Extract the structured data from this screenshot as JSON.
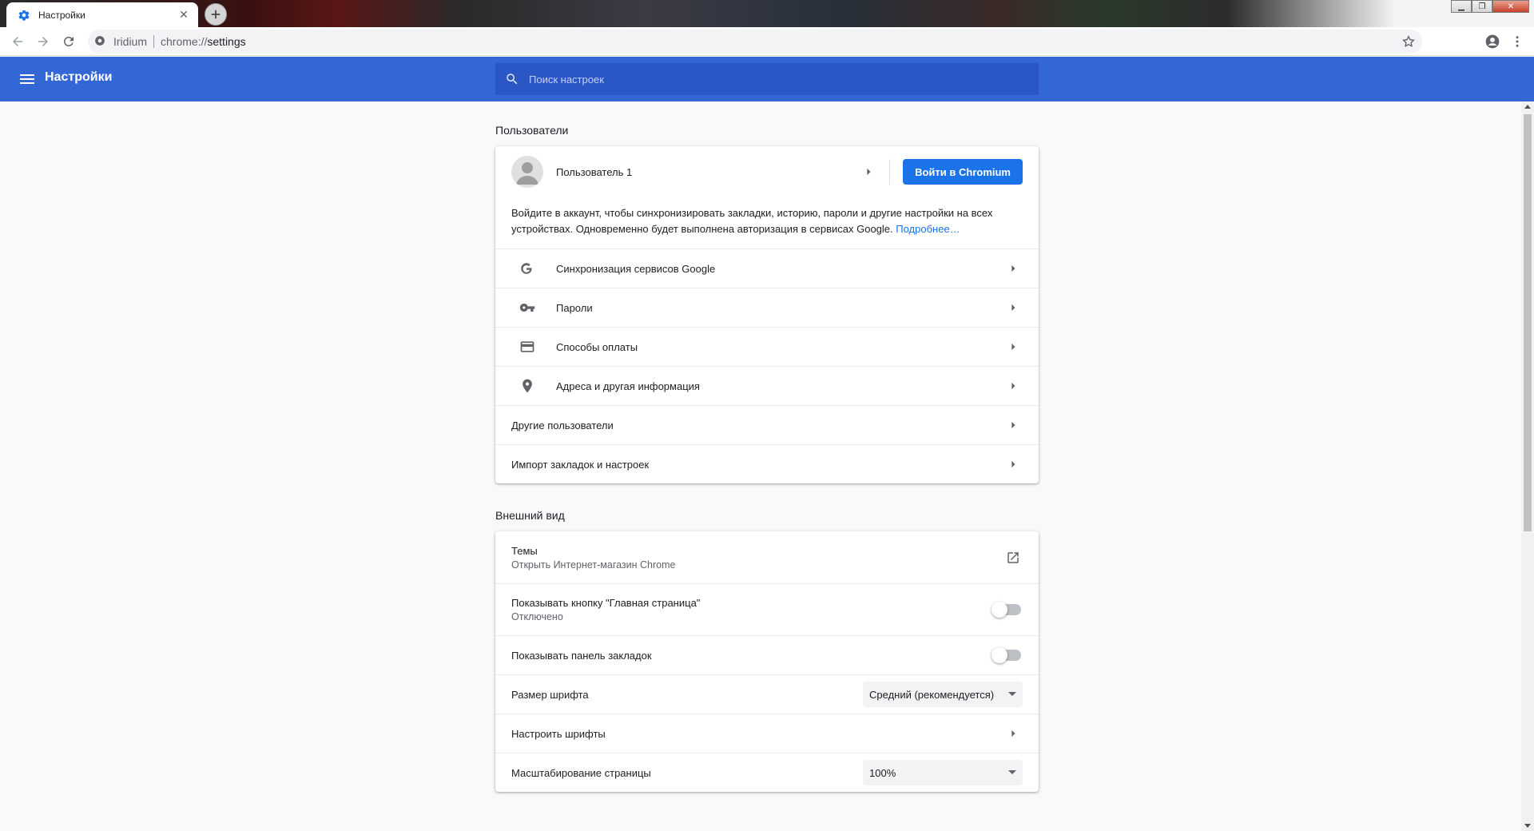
{
  "browser": {
    "tab_title": "Настройки",
    "omnibox_origin": "Iridium",
    "url_scheme": "chrome://",
    "url_rest": "settings"
  },
  "header": {
    "title": "Настройки",
    "search_placeholder": "Поиск настроек"
  },
  "people": {
    "section_title": "Пользователи",
    "user_name": "Пользователь 1",
    "signin_button": "Войти в Chromium",
    "sync_text": "Войдите в аккаунт, чтобы синхронизировать закладки, историю, пароли и другие настройки на всех устройствах. Одновременно будет выполнена авторизация в сервисах Google.",
    "learn_more": "Подробнее…",
    "items": [
      {
        "label": "Синхронизация сервисов Google",
        "icon": "google-g-icon"
      },
      {
        "label": "Пароли",
        "icon": "key-icon"
      },
      {
        "label": "Способы оплаты",
        "icon": "credit-card-icon"
      },
      {
        "label": "Адреса и другая информация",
        "icon": "location-pin-icon"
      }
    ],
    "other_users": "Другие пользователи",
    "import": "Импорт закладок и настроек"
  },
  "appearance": {
    "section_title": "Внешний вид",
    "themes_label": "Темы",
    "themes_sub": "Открыть Интернет-магазин Chrome",
    "home_button_label": "Показывать кнопку \"Главная страница\"",
    "home_button_sub": "Отключено",
    "home_button_enabled": false,
    "bookmarks_bar_label": "Показывать панель закладок",
    "bookmarks_bar_enabled": false,
    "font_size_label": "Размер шрифта",
    "font_size_value": "Средний (рекомендуется)",
    "customize_fonts_label": "Настроить шрифты",
    "page_zoom_label": "Масштабирование страницы",
    "page_zoom_value": "100%"
  },
  "colors": {
    "header_bg": "#3367d6",
    "search_bg": "#2a56c6",
    "primary_button": "#1a73e8",
    "link": "#1a73e8"
  }
}
